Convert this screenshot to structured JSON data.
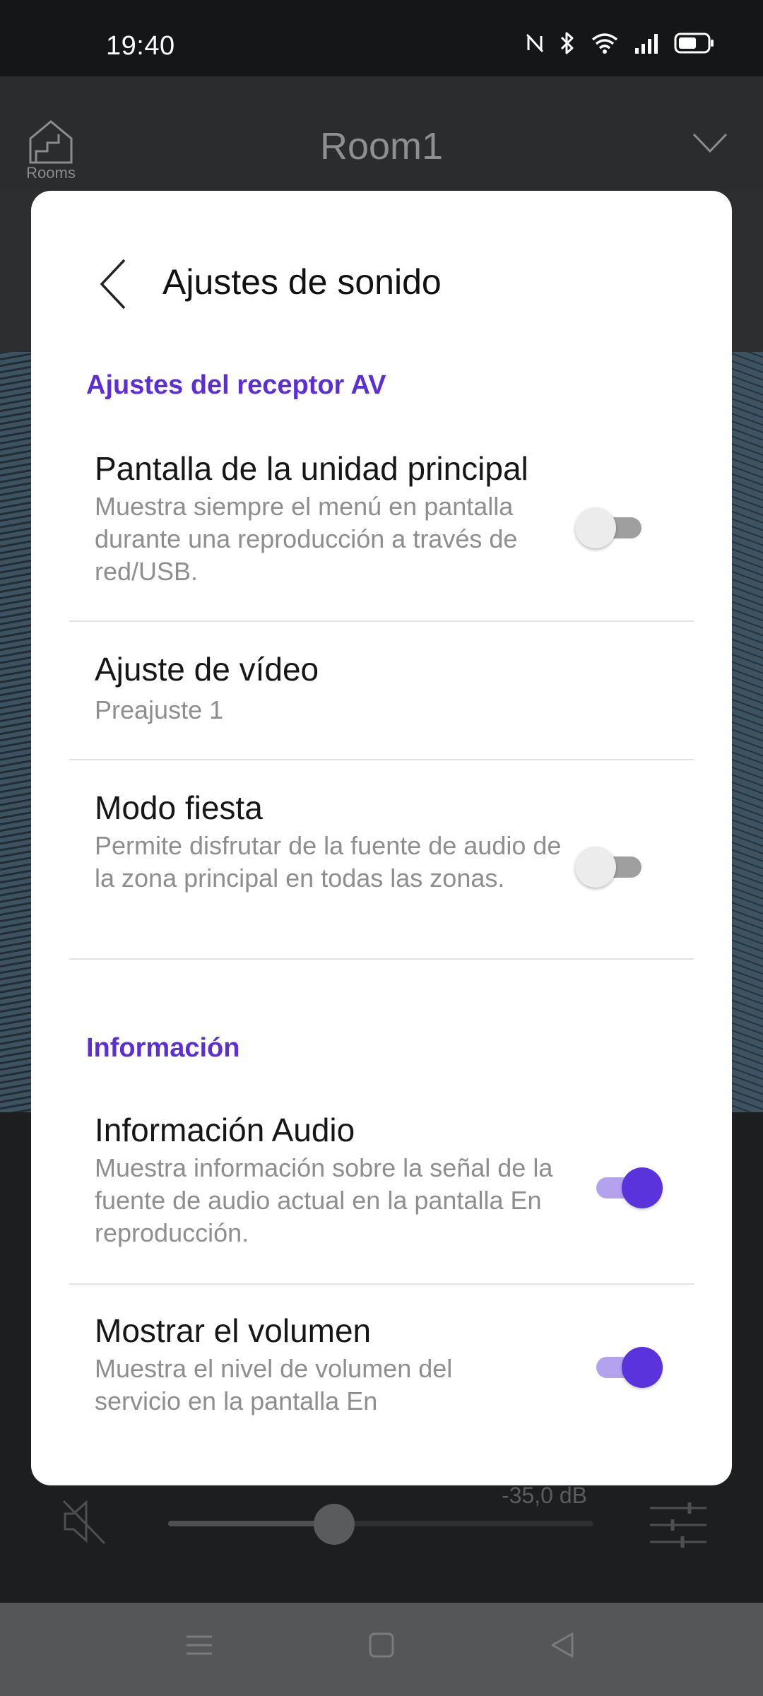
{
  "status_bar": {
    "time": "19:40"
  },
  "app_header": {
    "rooms_label": "Rooms",
    "title": "Room1"
  },
  "player": {
    "volume": "-35,0 dB",
    "volume_level": 0.39
  },
  "modal": {
    "title": "Ajustes de sonido",
    "sections": [
      {
        "title": "Ajustes del receptor AV",
        "rows": [
          {
            "title": "Pantalla de la unidad principal",
            "desc": "Muestra siempre el menú en pantalla durante una reproducción a través de red/USB.",
            "toggle": false
          },
          {
            "title": "Ajuste de vídeo",
            "desc": "Preajuste 1"
          },
          {
            "title": "Modo fiesta",
            "desc": "Permite disfrutar de la fuente de audio de la zona principal en todas las zonas.",
            "toggle": false
          }
        ]
      },
      {
        "title": "Información",
        "rows": [
          {
            "title": "Información Audio",
            "desc": "Muestra información sobre la señal de la fuente de audio actual en la pantalla En reproducción.",
            "toggle": true
          },
          {
            "title": "Mostrar el volumen",
            "desc": "Muestra el nivel de volumen del servicio en la pantalla En",
            "toggle": true
          }
        ]
      }
    ]
  },
  "colors": {
    "accent": "#5a33dc",
    "section_title": "#5b2ed8",
    "toggle_on_track": "#b5a2ee"
  }
}
